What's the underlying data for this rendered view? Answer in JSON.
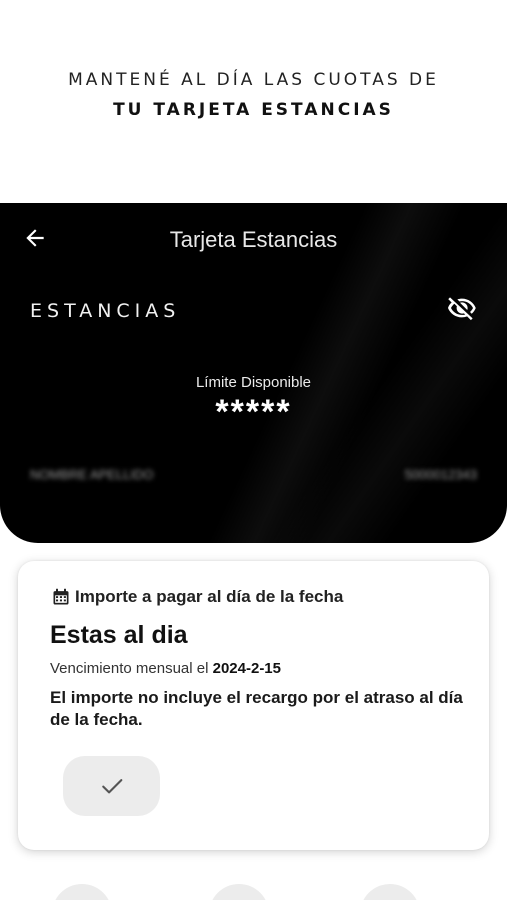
{
  "promo": {
    "line1": "MANTENÉ AL DÍA LAS CUOTAS DE",
    "line2": "TU TARJETA ESTANCIAS"
  },
  "header": {
    "title": "Tarjeta Estancias",
    "back_icon": "arrow-left-icon",
    "brand": "ESTANCIAS",
    "visibility_icon": "eye-off-icon",
    "limit_label": "Límite Disponible",
    "limit_value": "*****",
    "holder_name_blurred": "NOMBRE APELLIDO",
    "card_number_blurred": "5000012343"
  },
  "payment": {
    "icon": "calendar-icon",
    "heading": "Importe a pagar al día de la fecha",
    "status": "Estas al dia",
    "due_label": "Vencimiento mensual el",
    "due_date": "2024-2-15",
    "note": "El importe no incluye el recargo por el atraso al día de la fecha.",
    "confirm_icon": "check-icon"
  },
  "colors": {
    "header_bg": "#000000",
    "button_bg": "#ececec"
  }
}
